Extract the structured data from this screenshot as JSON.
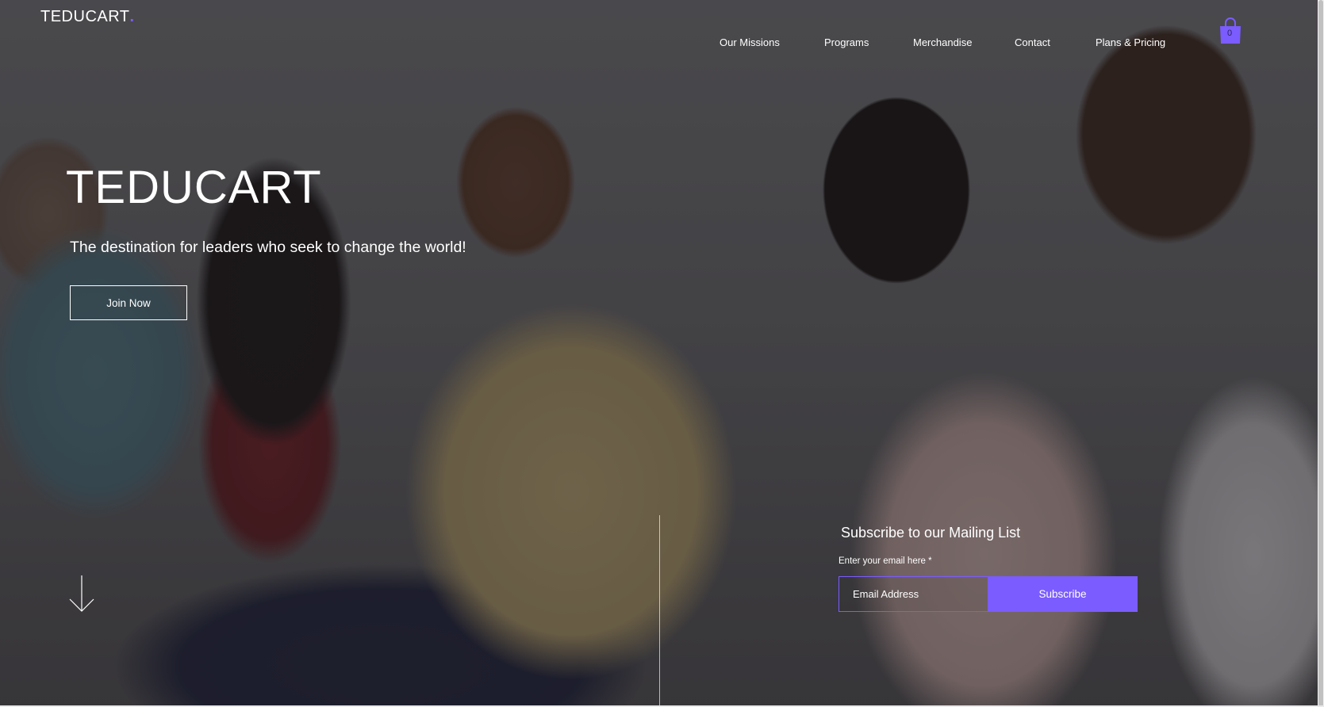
{
  "header": {
    "logo_text": "TEDUCART",
    "logo_dot": ".",
    "nav": [
      {
        "label": "Our Missions"
      },
      {
        "label": "Programs"
      },
      {
        "label": "Merchandise"
      },
      {
        "label": "Contact"
      },
      {
        "label": "Plans & Pricing"
      }
    ],
    "cart": {
      "icon": "shopping-bag-icon",
      "count": "0"
    }
  },
  "hero": {
    "title": "TEDUCART",
    "subtitle": "The destination for leaders who seek to change the world!",
    "cta_label": "Join Now",
    "scroll_icon": "arrow-down-icon"
  },
  "subscribe": {
    "title": "Subscribe to our Mailing List",
    "email_label": "Enter your email here *",
    "email_placeholder": "Email Address",
    "email_value": "",
    "button_label": "Subscribe"
  },
  "colors": {
    "accent": "#7b5cff",
    "text": "#ffffff"
  }
}
